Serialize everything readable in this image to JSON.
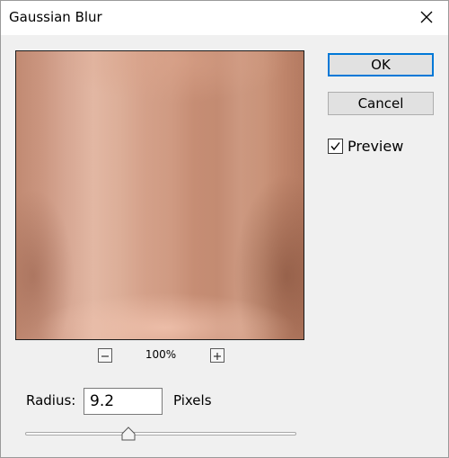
{
  "dialog": {
    "title": "Gaussian Blur",
    "close_icon": "close-icon"
  },
  "buttons": {
    "ok_label": "OK",
    "cancel_label": "Cancel"
  },
  "preview": {
    "label": "Preview",
    "checked": true,
    "image": "skin-texture-blurred"
  },
  "zoom": {
    "level": "100%",
    "zoom_out_icon": "minus-icon",
    "zoom_in_icon": "plus-icon"
  },
  "radius": {
    "label": "Radius:",
    "value": "9.2",
    "units": "Pixels",
    "slider_fraction": 0.38
  },
  "colors": {
    "accent": "#0078d7",
    "dialog_bg": "#f0f0f0",
    "titlebar_bg": "#ffffff"
  }
}
